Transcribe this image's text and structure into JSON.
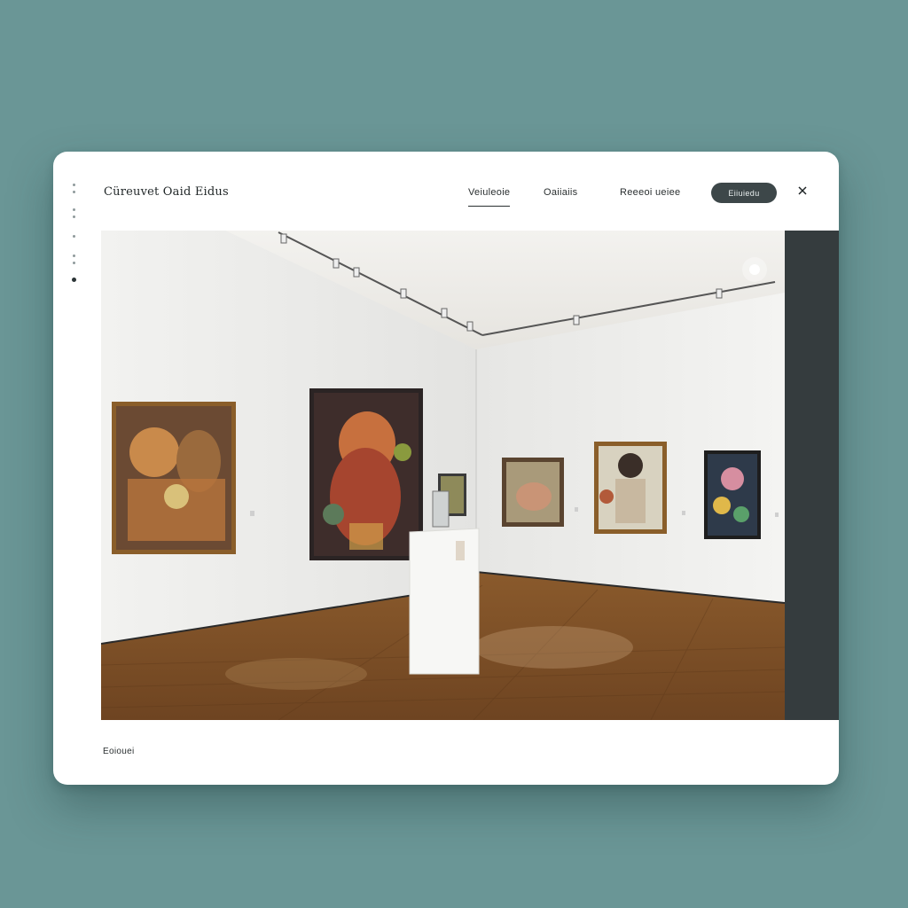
{
  "brand": {
    "title": "Cüreuvet Oaid Eidus"
  },
  "nav": {
    "items": [
      {
        "label": "Veiuleoie",
        "active": true
      },
      {
        "label": "Oaiiaiis",
        "active": false
      },
      {
        "label": "Reeeoi ueiee",
        "active": false
      }
    ],
    "cta_label": "Eiiuiedu",
    "close_icon": "close-icon"
  },
  "side_rail": {
    "icon": "vertical-dots-icon"
  },
  "hero": {
    "image": "art-gallery-interior-photo"
  },
  "footer": {
    "label": "Eoiouei"
  },
  "colors": {
    "background": "#6a9696",
    "card": "#ffffff",
    "cta": "#3d4749",
    "dark_panel": "#353c3e"
  }
}
